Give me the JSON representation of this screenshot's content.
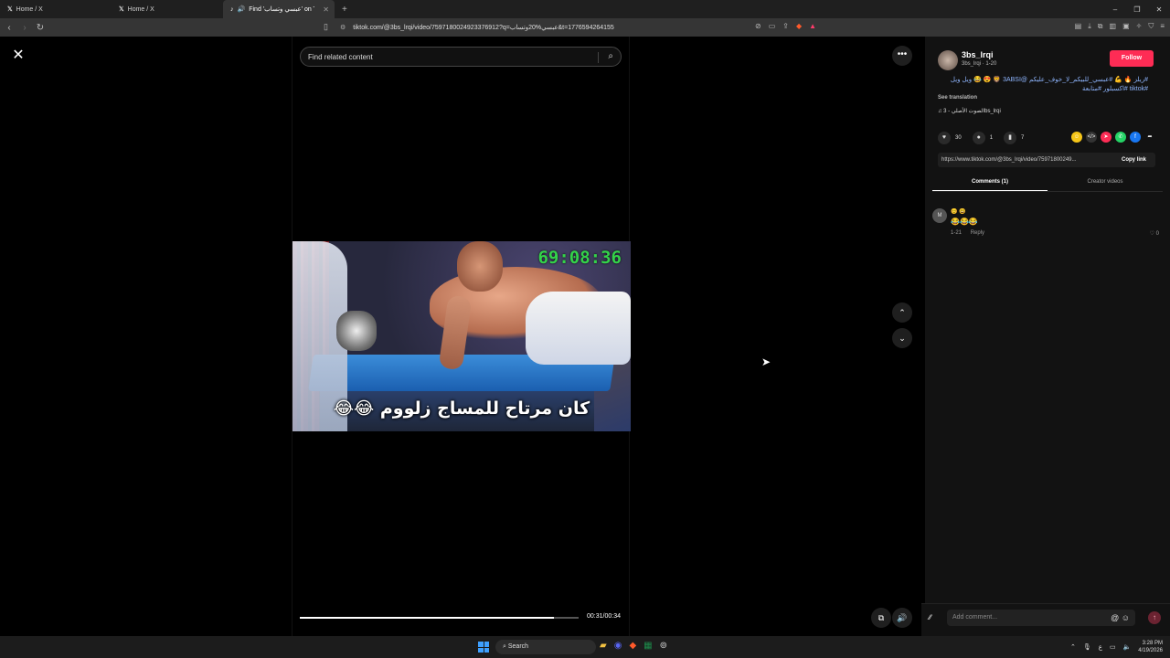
{
  "browser": {
    "tabs": [
      {
        "label": "Home / X",
        "icon": "x-logo-icon"
      },
      {
        "label": "Home / X",
        "icon": "x-logo-icon"
      },
      {
        "label": "Find 'عبسي وتساب' on TikTok",
        "icon": "tiktok-icon",
        "active": true
      }
    ],
    "url": "tiktok.com/@3bs_lrqi/video/7597180024923376912?q=عبسي%20وتساب&t=1776594264155"
  },
  "player": {
    "search_placeholder": "Find related content",
    "overlay_timer": "69:08:36",
    "caption": "كان مرتاح للمساج زلووم 😂😂",
    "time": "00:31/00:34",
    "progress": 0.91
  },
  "panel": {
    "username": "3bs_lrqi",
    "subline": "3bs_lrqi · 1-20",
    "follow_label": "Follow",
    "description_line1": "#ريلز 🔥 💪 #عبسي_للبيكم_لا_خوف_عليكم @3ABSI 🦁 😍 😂 ويل ويل",
    "description_line2": "#tiktok #اكسبلور #متابعة",
    "see_translation": "See translation",
    "music": "الصوت الأصلي - 3bs_lrqi",
    "likes": "30",
    "comments": "1",
    "saves": "7",
    "link": "https://www.tiktok.com/@3bs_lrqi/video/75971800249...",
    "copy_label": "Copy link",
    "tab_comments": "Comments (1)",
    "tab_creator": "Creator videos",
    "comment": {
      "avatar_letter": "M",
      "user": "😊 😃",
      "text": "😂😂😂",
      "date": "1-21",
      "reply": "Reply",
      "likes": "0"
    },
    "add_comment_placeholder": "Add comment..."
  },
  "taskbar": {
    "search_label": "Search",
    "time": "3:28 PM",
    "date": "4/19/2026"
  }
}
